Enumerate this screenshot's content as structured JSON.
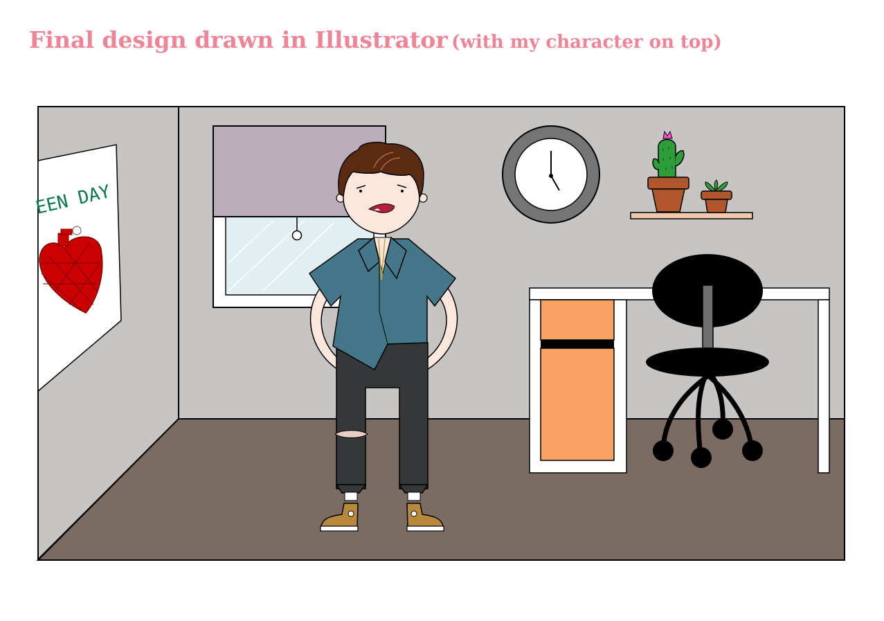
{
  "title": {
    "main": "Final design drawn in Illustrator",
    "sub": "(with my character on top)"
  },
  "poster": {
    "band_name": "EEN DAY"
  },
  "colors": {
    "title": "#f08497",
    "wall": "#c6c5c4",
    "floor": "#7a6c63",
    "blind": "#b9aeba",
    "window_glass": "#e1eef2",
    "shirt": "#44778a",
    "pants": "#353738",
    "skin": "#fde6dc",
    "hair": "#5a2b12",
    "drawer": "#f9a165",
    "heart": "#cc0000",
    "poster_text": "#0b7a46",
    "cactus": "#2e9e3a",
    "pot": "#b0562d",
    "clock_rim": "#757575"
  }
}
